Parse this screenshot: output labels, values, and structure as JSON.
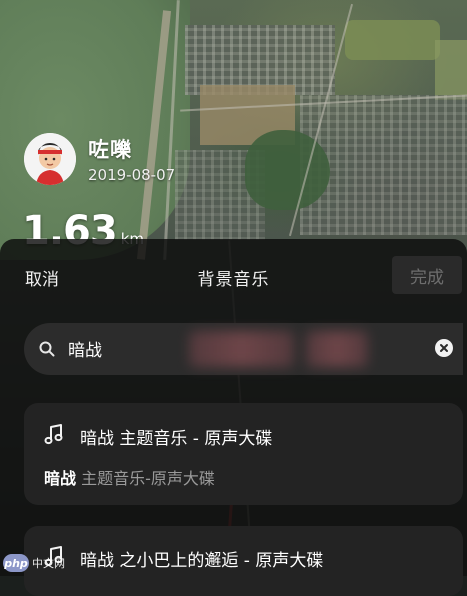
{
  "profile": {
    "name": "咗嚛",
    "date": "2019-08-07",
    "distance_value": "1.63",
    "distance_unit": "km"
  },
  "sheet": {
    "cancel_label": "取消",
    "title": "背景音乐",
    "done_label": "完成"
  },
  "search": {
    "query": "暗战",
    "icon": "search-icon",
    "clear_icon": "clear-icon"
  },
  "results": [
    {
      "icon": "music-note-icon",
      "title": "暗战 主题音乐 - 原声大碟",
      "subtitle_match": "暗战",
      "subtitle_rest": " 主题音乐-原声大碟"
    },
    {
      "icon": "music-note-icon",
      "title": "暗战 之小巴上的邂逅 - 原声大碟"
    }
  ],
  "watermark": {
    "logo_text": "php",
    "text": "中文网"
  },
  "colors": {
    "route": "#c9443a",
    "sheet_bg": "#0c0c0c",
    "card_bg": "#232323",
    "muted_text": "#9a9a9a"
  }
}
